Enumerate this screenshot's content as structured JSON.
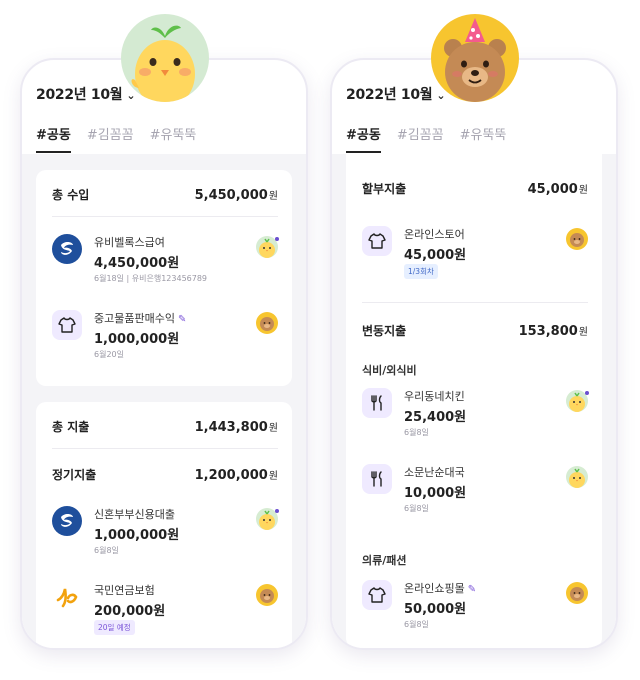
{
  "left": {
    "month": "2022년 10월",
    "tabs": [
      "#공동",
      "#김꼼꼼",
      "#유뚝뚝"
    ],
    "income": {
      "label": "총 수입",
      "total": "5,450,000",
      "won": "원",
      "items": [
        {
          "name": "유비벨록스급여",
          "value": "4,450,000원",
          "meta": "6월18일 | 유비은행123456789",
          "icon": "bank-logo-icon",
          "owner": "chick"
        },
        {
          "name": "중고물품판매수익",
          "value": "1,000,000원",
          "meta": "6월20일",
          "icon": "shirt-icon",
          "owner": "bear",
          "edited": true
        }
      ]
    },
    "expense": {
      "label": "총 지출",
      "total": "1,443,800",
      "won": "원",
      "regular_label": "정기지출",
      "regular_total": "1,200,000",
      "items": [
        {
          "name": "신혼부부신용대출",
          "value": "1,000,000원",
          "meta": "6월8일",
          "icon": "bank-logo-icon",
          "owner": "chick"
        },
        {
          "name": "국민연금보험",
          "value": "200,000원",
          "badge": "20일 예정",
          "icon": "pension-logo-icon",
          "owner": "bear"
        }
      ]
    }
  },
  "right": {
    "month": "2022년 10월",
    "tabs": [
      "#공동",
      "#김꼼꼼",
      "#유뚝뚝"
    ],
    "installment": {
      "label": "할부지출",
      "total": "45,000",
      "won": "원",
      "item": {
        "name": "온라인스토어",
        "value": "45,000원",
        "badge": "1/3회차",
        "icon": "shirt-icon",
        "owner": "bear"
      }
    },
    "variable": {
      "label": "변동지출",
      "total": "153,800",
      "won": "원",
      "food_label": "식비/외식비",
      "food_items": [
        {
          "name": "우리동네치킨",
          "value": "25,400원",
          "meta": "6월8일",
          "icon": "fork-knife-icon",
          "owner": "chick"
        },
        {
          "name": "소문난순대국",
          "value": "10,000원",
          "meta": "6월8일",
          "icon": "fork-knife-icon",
          "owner": "chick"
        }
      ],
      "clothes_label": "의류/패션",
      "clothes_items": [
        {
          "name": "온라인쇼핑몰",
          "value": "50,000원",
          "meta": "6월8일",
          "icon": "shirt-icon",
          "owner": "bear",
          "edited": true
        }
      ]
    }
  },
  "colors": {
    "accent": "#7b55d8",
    "icon_bg": "#efeaff",
    "bg": "#f4f4f7",
    "chick_bg": "#d4ead2",
    "bear_bg": "#f7c52f"
  }
}
